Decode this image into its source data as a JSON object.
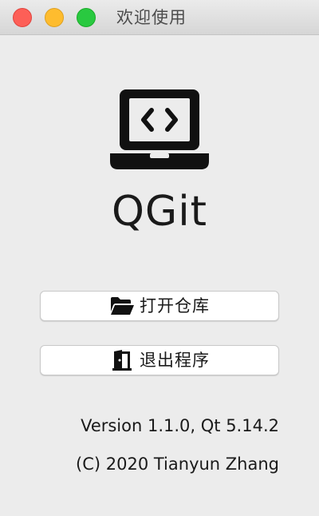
{
  "window": {
    "title": "欢迎使用"
  },
  "app": {
    "name": "QGit",
    "icon": "laptop-code-icon"
  },
  "buttons": {
    "open_repo": {
      "label": "打开仓库",
      "icon": "folder-open-icon"
    },
    "exit": {
      "label": "退出程序",
      "icon": "door-exit-icon"
    }
  },
  "footer": {
    "version": "Version 1.1.0, Qt 5.14.2",
    "copyright": "(C) 2020 Tianyun Zhang"
  },
  "colors": {
    "close": "#fd5f57",
    "minimize": "#febc2e",
    "maximize": "#29c940",
    "background": "#ececec",
    "text": "#1a1a1a"
  }
}
